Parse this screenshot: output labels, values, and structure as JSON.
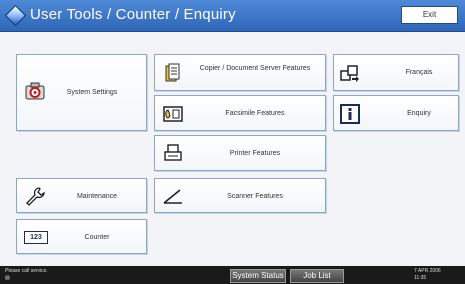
{
  "header": {
    "title": "User Tools / Counter / Enquiry",
    "exit_label": "Exit"
  },
  "buttons": {
    "system_settings": "System Settings",
    "copier_features": "Copier / Document Server Features",
    "francais": "Français",
    "facsimile_features": "Facsimile Features",
    "enquiry": "Enquiry",
    "printer_features": "Printer Features",
    "maintenance": "Maintenance",
    "scanner_features": "Scanner Features",
    "counter": "Counter",
    "counter_icon_text": "123"
  },
  "statusbar": {
    "message": "Please call service.",
    "system_status": "System Status",
    "job_list": "Job List",
    "date": "7 APR 2006",
    "time": "11:35"
  }
}
